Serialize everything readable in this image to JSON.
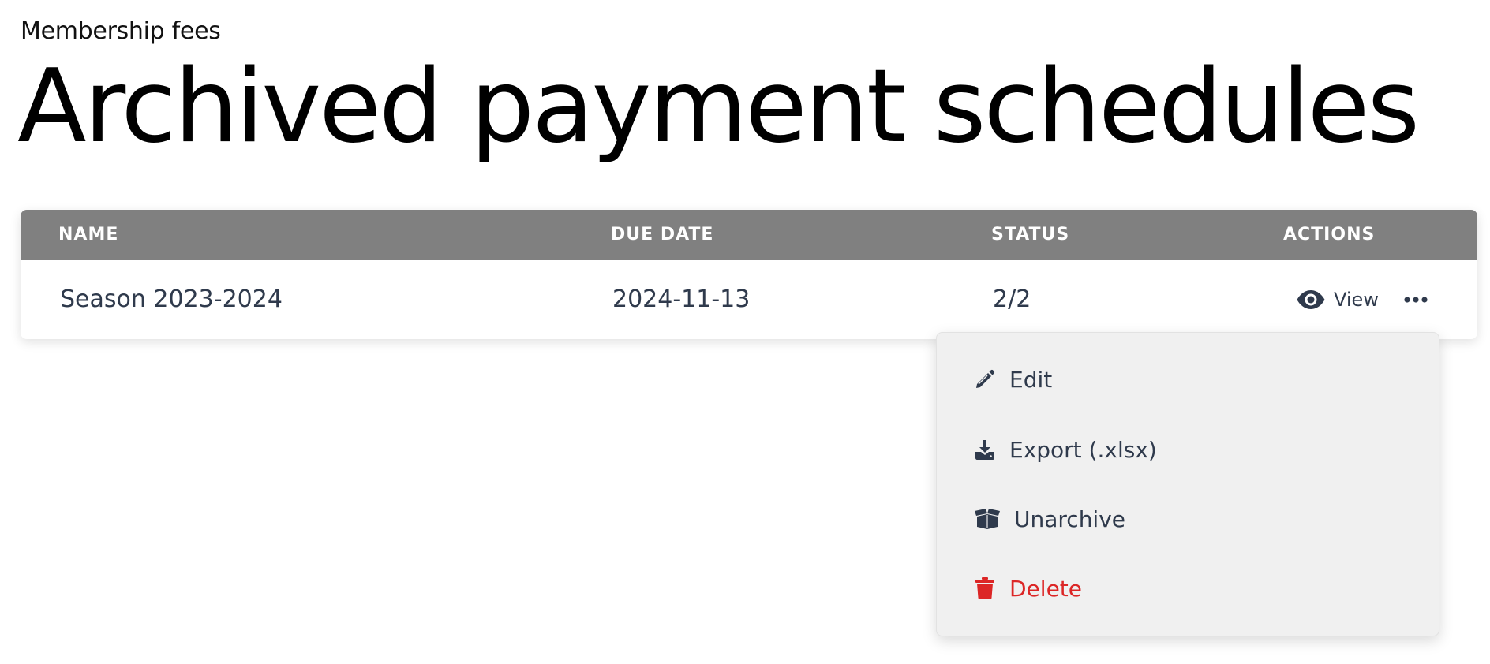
{
  "header": {
    "section": "Membership fees",
    "title": "Archived payment schedules"
  },
  "table": {
    "columns": [
      "NAME",
      "DUE DATE",
      "STATUS",
      "ACTIONS"
    ],
    "rows": [
      {
        "name": "Season 2023-2024",
        "due_date": "2024-11-13",
        "status": "2/2",
        "view_label": "View"
      }
    ]
  },
  "dropdown": {
    "items": [
      {
        "label": "Edit",
        "icon": "pencil-icon"
      },
      {
        "label": "Export (.xlsx)",
        "icon": "download-icon"
      },
      {
        "label": "Unarchive",
        "icon": "box-open-icon"
      },
      {
        "label": "Delete",
        "icon": "trash-icon",
        "color": "#dc2626"
      }
    ]
  },
  "colors": {
    "header_bg": "#808080",
    "text": "#2f3a4c",
    "danger": "#dc2626",
    "menu_bg": "#f0f0f0"
  }
}
